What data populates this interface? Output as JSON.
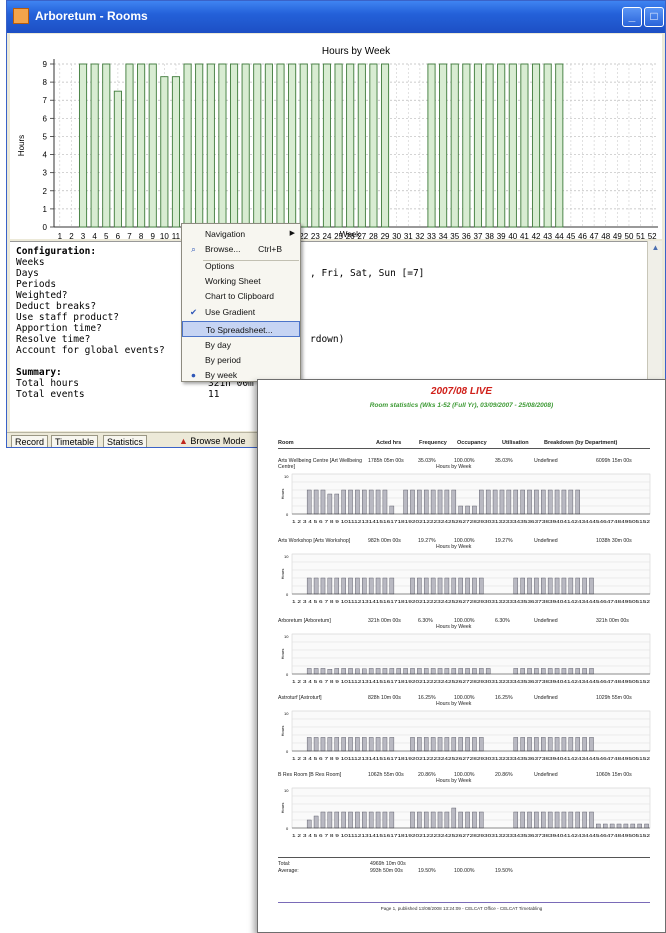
{
  "window": {
    "title": "Arboretum - Rooms",
    "buttons": {
      "minimize": "_",
      "maximize": "□",
      "close": "✕"
    }
  },
  "chart_data": {
    "type": "bar",
    "title": "Hours by Week",
    "xlabel": "Week",
    "ylabel": "Hours",
    "ylim": [
      0,
      9
    ],
    "y_ticks": [
      "0",
      "1",
      "2",
      "3",
      "4",
      "5",
      "6",
      "7",
      "8",
      "9"
    ],
    "categories": [
      "1",
      "2",
      "3",
      "4",
      "5",
      "6",
      "7",
      "8",
      "9",
      "10",
      "11",
      "12",
      "13",
      "14",
      "15",
      "16",
      "17",
      "18",
      "19",
      "20",
      "21",
      "22",
      "23",
      "24",
      "25",
      "26",
      "27",
      "28",
      "29",
      "30",
      "31",
      "32",
      "33",
      "34",
      "35",
      "36",
      "37",
      "38",
      "39",
      "40",
      "41",
      "42",
      "43",
      "44",
      "45",
      "46",
      "47",
      "48",
      "49",
      "50",
      "51",
      "52"
    ],
    "values": [
      0,
      0,
      9,
      9,
      9,
      7.5,
      9,
      9,
      9,
      8.3,
      8.3,
      9,
      9,
      9,
      9,
      9,
      9,
      9,
      9,
      9,
      9,
      9,
      9,
      9,
      9,
      9,
      9,
      9,
      9,
      0,
      0,
      0,
      9,
      9,
      9,
      9,
      9,
      9,
      9,
      9,
      9,
      9,
      9,
      9,
      0,
      0,
      0,
      0,
      0,
      0,
      0,
      0
    ],
    "grid": true,
    "bar_color": "#d8ecd2",
    "bar_edge": "#3e7a3a"
  },
  "config": {
    "rows": [
      {
        "label": "Configuration:",
        "value": ""
      },
      {
        "label": "Weeks",
        "value": ""
      },
      {
        "label": "Days",
        "value": ", Fri, Sat, Sun [=7]"
      },
      {
        "label": "Periods",
        "value": ""
      },
      {
        "label": "Weighted?",
        "value": ""
      },
      {
        "label": "Deduct breaks?",
        "value": ""
      },
      {
        "label": "Use staff product?",
        "value": ""
      },
      {
        "label": "Apportion time?",
        "value": ""
      },
      {
        "label": "Resolve time?",
        "value": "rdown)"
      },
      {
        "label": "Account for global events?",
        "value": ""
      },
      {
        "label": "",
        "value": ""
      },
      {
        "label": "Summary:",
        "value": ""
      },
      {
        "label": "Total hours",
        "value": "321h 00m O"
      },
      {
        "label": "Total events",
        "value": "11"
      }
    ]
  },
  "statusbar": {
    "tabs": [
      "Record",
      "Timetable",
      "Statistics"
    ],
    "mode": "Browse Mode"
  },
  "menu": {
    "items": [
      {
        "label": "Navigation",
        "shortcut": "",
        "submenu": true,
        "mark": ""
      },
      {
        "label": "Browse...",
        "shortcut": "Ctrl+B",
        "submenu": false,
        "mark": "⌕"
      },
      {
        "label": "Options",
        "shortcut": "",
        "submenu": false,
        "mark": ""
      },
      {
        "label": "Working Sheet",
        "shortcut": "",
        "submenu": false,
        "mark": ""
      },
      {
        "label": "Chart to Clipboard",
        "shortcut": "",
        "submenu": false,
        "mark": ""
      },
      {
        "label": "Use Gradient",
        "shortcut": "",
        "submenu": false,
        "mark": "✔"
      },
      {
        "label": "To Spreadsheet...",
        "shortcut": "",
        "submenu": false,
        "mark": ""
      },
      {
        "label": "By day",
        "shortcut": "",
        "submenu": false,
        "mark": ""
      },
      {
        "label": "By period",
        "shortcut": "",
        "submenu": false,
        "mark": ""
      },
      {
        "label": "By week",
        "shortcut": "",
        "submenu": false,
        "mark": "●"
      }
    ],
    "highlighted": "To Spreadsheet..."
  },
  "report": {
    "title": "2007/08 LIVE",
    "subtitle": "Room statistics (Wks 1-52 (Full Yr), 03/09/2007 - 25/08/2008)",
    "headers": [
      "Room",
      "Acted hrs",
      "Frequency",
      "Occupancy",
      "Utilisation",
      "Breakdown (by Department)"
    ],
    "mini_chart_title": "Hours by Week",
    "mini_chart_ylabel": "Hours",
    "mini_chart_ticks": "1 2 3 4 5 6 7 8 9 10111213141516171819202122232425262728293031323334353637383940414243444546474849505152",
    "rooms": [
      {
        "name": "Arts Wellbeing Centre [Art Wellbeing Centre]",
        "hours": "1785h 05m 00s",
        "frequency": "35.03%",
        "occupancy": "100.00%",
        "utilisation": "35.03%",
        "breakdown": "Undefined",
        "dept": "6099h 15m 00s"
      },
      {
        "name": "Arts Workshop [Arts Workshop]",
        "hours": "982h 00m 00s",
        "frequency": "19.27%",
        "occupancy": "100.00%",
        "utilisation": "19.27%",
        "breakdown": "Undefined",
        "dept": "1038h 30m 00s"
      },
      {
        "name": "Arboretum [Arboretum]",
        "hours": "321h 00m 00s",
        "frequency": "6.30%",
        "occupancy": "100.00%",
        "utilisation": "6.30%",
        "breakdown": "Undefined",
        "dept": "321h 00m 00s"
      },
      {
        "name": "Astroturf [Astroturf]",
        "hours": "828h 10m 00s",
        "frequency": "16.25%",
        "occupancy": "100.00%",
        "utilisation": "16.25%",
        "breakdown": "Undefined",
        "dept": "1029h 55m 00s"
      },
      {
        "name": "B Res Room [B Res Room]",
        "hours": "1062h 55m 00s",
        "frequency": "20.86%",
        "occupancy": "100.00%",
        "utilisation": "20.86%",
        "breakdown": "Undefined",
        "dept": "1060h 15m 00s"
      }
    ],
    "total_label": "Total:",
    "total_value": "4969h 10m 00s",
    "average_label": "Average:",
    "average_hours": "993h 50m 00s",
    "average_frequency": "19.50%",
    "average_occupancy": "100.00%",
    "average_utilisation": "19.50%",
    "footer": "Page 1, published 13/08/2008 13:24:09 - CELCAT Office - CELCAT Timetabling"
  }
}
